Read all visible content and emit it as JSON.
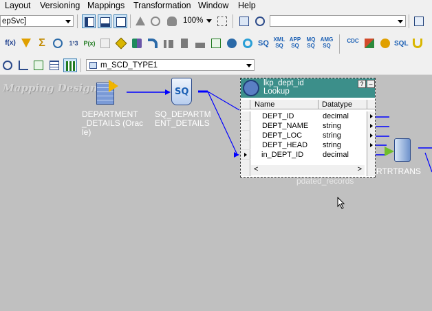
{
  "menu": {
    "layout": "Layout",
    "versioning": "Versioning",
    "mappings": "Mappings",
    "transformation": "Transformation",
    "window": "Window",
    "help": "Help"
  },
  "toolbar1": {
    "service_value": "epSvc]",
    "zoom_value": "100%",
    "empty_combo_value": ""
  },
  "toolbar2": {
    "glyph_fx": "f(x)",
    "glyph_sigma": "Σ",
    "glyph_123": "1²3",
    "glyph_pcode": "P(x)",
    "glyph_seq": "SQ",
    "glyph_xml": "XML SQ",
    "glyph_app": "APP SQ",
    "glyph_mq": "MQ SQ",
    "glyph_amg": "AMG SQ",
    "glyph_cdc": "CDC",
    "glyph_sql": "SQL"
  },
  "toolbar3": {
    "mapping_name": "m_SCD_TYPE1"
  },
  "canvas": {
    "watermark": "Mapping Designer",
    "source_label_1": "DEPARTMENT",
    "source_label_2": "_DETAILS (Orac",
    "source_label_3": "le)",
    "sq_label_1": "SQ_DEPARTM",
    "sq_label_2": "ENT_DETAILS",
    "sq_icon_text": "SQ",
    "router_label": "RTRTRANS",
    "hidden_label": "pdated_records"
  },
  "lookup": {
    "title": "lkp_dept_id",
    "subtitle": "Lookup",
    "help_button": "?",
    "minimize_button": "–",
    "col_name": "Name",
    "col_datatype": "Datatype",
    "rows": [
      {
        "name": "DEPT_ID",
        "type": "decimal"
      },
      {
        "name": "DEPT_NAME",
        "type": "string"
      },
      {
        "name": "DEPT_LOC",
        "type": "string"
      },
      {
        "name": "DEPT_HEAD",
        "type": "string"
      },
      {
        "name": "in_DEPT_ID",
        "type": "decimal"
      }
    ],
    "scroll_left": "<",
    "scroll_right": ">"
  },
  "colors": {
    "toolbar_bg": "#f0f0f0",
    "canvas_bg": "#c0c0c0",
    "link_blue": "#0000ff",
    "lookup_header": "#3c8f8a"
  }
}
